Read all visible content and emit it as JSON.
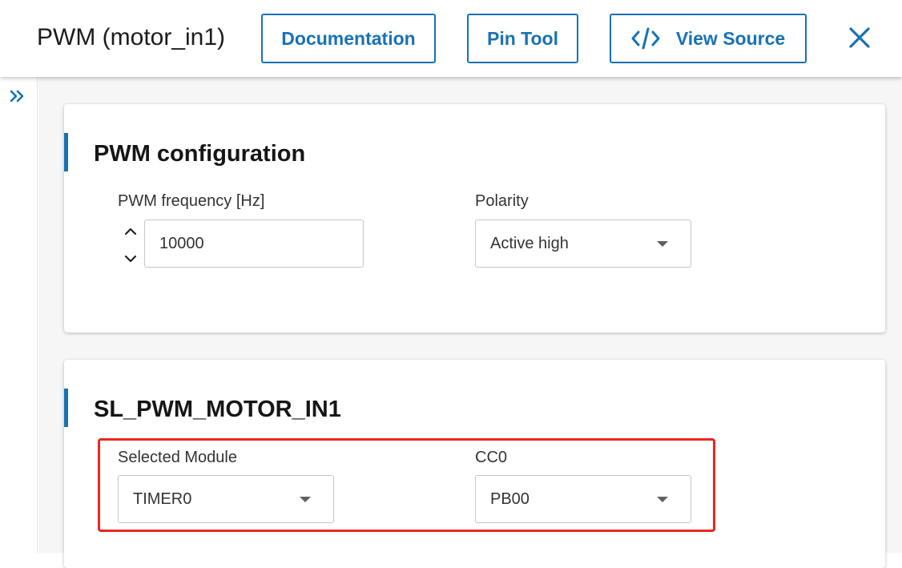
{
  "header": {
    "title": "PWM (motor_in1)",
    "buttons": {
      "documentation": "Documentation",
      "pin_tool": "Pin Tool",
      "view_source": "View Source"
    },
    "icons": {
      "code": "code-icon",
      "close": "close-icon",
      "expand": "double-chevron-right-icon"
    },
    "accent_color": "#1872b3"
  },
  "cards": {
    "pwm_config": {
      "title": "PWM configuration",
      "frequency_label": "PWM frequency [Hz]",
      "frequency_value": "10000",
      "polarity_label": "Polarity",
      "polarity_value": "Active high"
    },
    "instance": {
      "title": "SL_PWM_MOTOR_IN1",
      "module_label": "Selected Module",
      "module_value": "TIMER0",
      "cc0_label": "CC0",
      "cc0_value": "PB00"
    }
  },
  "annotation": {
    "highlight_color": "#e8281d"
  }
}
